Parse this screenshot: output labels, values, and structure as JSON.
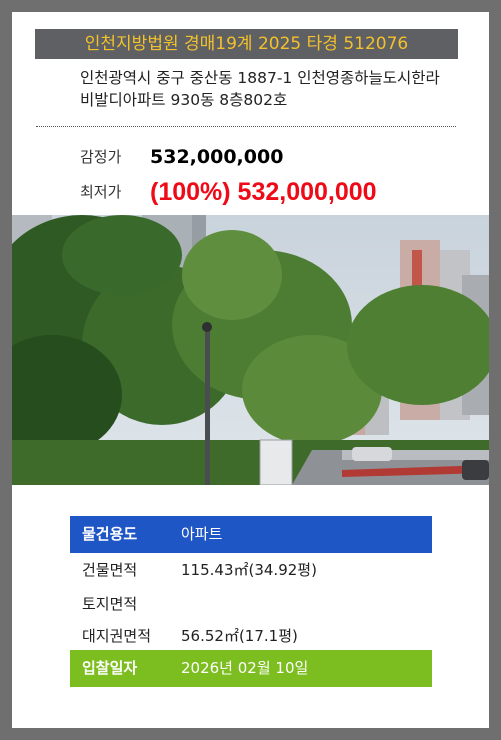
{
  "header": {
    "title": "인천지방법원 경매19계 2025 타경 512076"
  },
  "address": {
    "line1": "인천광역시 중구 중산동 1887-1 인천영종하늘도시한라",
    "line2": "비발디아파트 930동 8층802호"
  },
  "prices": {
    "appraisal_label": "감정가",
    "appraisal_value": "532,000,000",
    "minimum_label": "최저가",
    "minimum_value": "(100%) 532,000,000"
  },
  "details": {
    "usage_label": "물건용도",
    "usage_value": "아파트",
    "building_area_label": "건물면적",
    "building_area_value": "115.43㎡(34.92평)",
    "land_area_label": "토지면적",
    "land_area_value": "",
    "land_right_area_label": "대지권면적",
    "land_right_area_value": "56.52㎡(17.1평)",
    "bid_date_label": "입찰일자",
    "bid_date_value": "2026년 02월 10일"
  },
  "colors": {
    "title_text": "#f3c12b",
    "title_bg": "#5e6063",
    "minimum_price": "#ee0a16",
    "usage_bar": "#1f56c6",
    "bid_date_bar": "#7cbd1f"
  }
}
